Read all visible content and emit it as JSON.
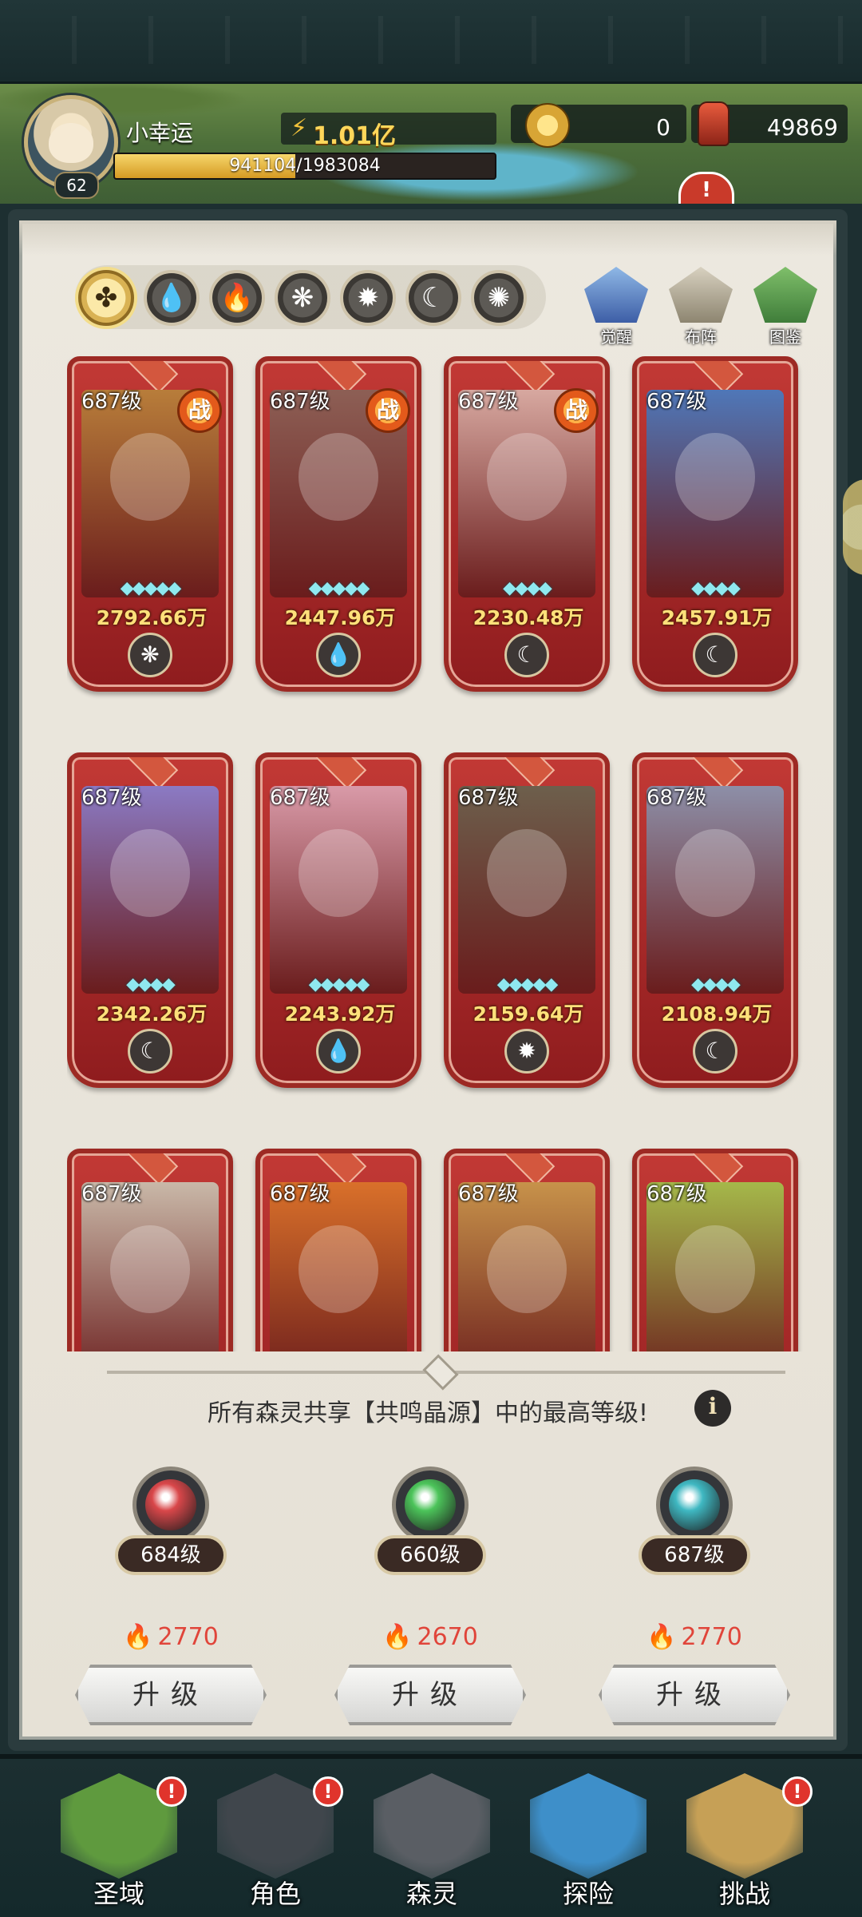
{
  "player": {
    "name": "小幸运",
    "level": "62",
    "power": "1.01亿",
    "exp_text": "941104/1983084",
    "exp_fraction": 0.4746
  },
  "resources": {
    "coins": "0",
    "relics": "49869"
  },
  "element_tabs": [
    {
      "name": "all",
      "glyph": "✤",
      "active": true
    },
    {
      "name": "water",
      "glyph": "💧",
      "active": false
    },
    {
      "name": "fire",
      "glyph": "🔥",
      "active": false
    },
    {
      "name": "wind",
      "glyph": "❋",
      "active": false
    },
    {
      "name": "light",
      "glyph": "✹",
      "active": false
    },
    {
      "name": "moon",
      "glyph": "☾",
      "active": false
    },
    {
      "name": "void",
      "glyph": "✺",
      "active": false
    }
  ],
  "side_buttons": {
    "awaken": "觉醒",
    "formation": "布阵",
    "codex": "图鉴"
  },
  "heroes": [
    {
      "level": "687级",
      "power": "2792.66万",
      "in_battle": true,
      "battle_label": "战",
      "element": "wind",
      "glyph": "❋",
      "stars": "◆◆◆◆◆",
      "color": "#b87d3a"
    },
    {
      "level": "687级",
      "power": "2447.96万",
      "in_battle": true,
      "battle_label": "战",
      "element": "water",
      "glyph": "💧",
      "stars": "◆◆◆◆◆",
      "color": "#8d5f55"
    },
    {
      "level": "687级",
      "power": "2230.48万",
      "in_battle": true,
      "battle_label": "战",
      "element": "moon",
      "glyph": "☾",
      "stars": "◆◆◆◆",
      "color": "#d7a8a0"
    },
    {
      "level": "687级",
      "power": "2457.91万",
      "in_battle": false,
      "battle_label": "",
      "element": "moon",
      "glyph": "☾",
      "stars": "◆◆◆◆",
      "color": "#4f77b8"
    },
    {
      "level": "687级",
      "power": "2342.26万",
      "in_battle": false,
      "battle_label": "",
      "element": "moon",
      "glyph": "☾",
      "stars": "◆◆◆◆",
      "color": "#8b7ac4"
    },
    {
      "level": "687级",
      "power": "2243.92万",
      "in_battle": false,
      "battle_label": "",
      "element": "water",
      "glyph": "💧",
      "stars": "◆◆◆◆◆",
      "color": "#d99aa8"
    },
    {
      "level": "687级",
      "power": "2159.64万",
      "in_battle": false,
      "battle_label": "",
      "element": "light",
      "glyph": "✹",
      "stars": "◆◆◆◆◆",
      "color": "#6d5f4c"
    },
    {
      "level": "687级",
      "power": "2108.94万",
      "in_battle": false,
      "battle_label": "",
      "element": "moon",
      "glyph": "☾",
      "stars": "◆◆◆◆",
      "color": "#8d8fa8"
    },
    {
      "level": "687级",
      "power": "",
      "in_battle": false,
      "battle_label": "",
      "element": "",
      "glyph": "",
      "stars": "",
      "color": "#c9b8a8"
    },
    {
      "level": "687级",
      "power": "",
      "in_battle": false,
      "battle_label": "",
      "element": "",
      "glyph": "",
      "stars": "",
      "color": "#d9702a"
    },
    {
      "level": "687级",
      "power": "",
      "in_battle": false,
      "battle_label": "",
      "element": "",
      "glyph": "",
      "stars": "",
      "color": "#c7924a"
    },
    {
      "level": "687级",
      "power": "",
      "in_battle": false,
      "battle_label": "",
      "element": "",
      "glyph": "",
      "stars": "",
      "color": "#a5b84a"
    }
  ],
  "resonance": {
    "info": "所有森灵共享【共鸣晶源】中的最高等级!",
    "info_icon": "i",
    "crystals": [
      {
        "level": "684级",
        "cost": "2770",
        "orb_color": "#d9474a",
        "button": "升级"
      },
      {
        "level": "660级",
        "cost": "2670",
        "orb_color": "#4cc45a",
        "button": "升级"
      },
      {
        "level": "687级",
        "cost": "2770",
        "orb_color": "#3fb8c2",
        "button": "升级"
      }
    ]
  },
  "alert_mark": "!",
  "bottom_nav": [
    {
      "label": "圣域",
      "alert": true,
      "color": "#5f9a3e"
    },
    {
      "label": "角色",
      "alert": true,
      "color": "#40464c"
    },
    {
      "label": "森灵",
      "alert": false,
      "color": "#5a5e64"
    },
    {
      "label": "探险",
      "alert": false,
      "color": "#3e8fc9"
    },
    {
      "label": "挑战",
      "alert": true,
      "color": "#c6a056"
    }
  ]
}
